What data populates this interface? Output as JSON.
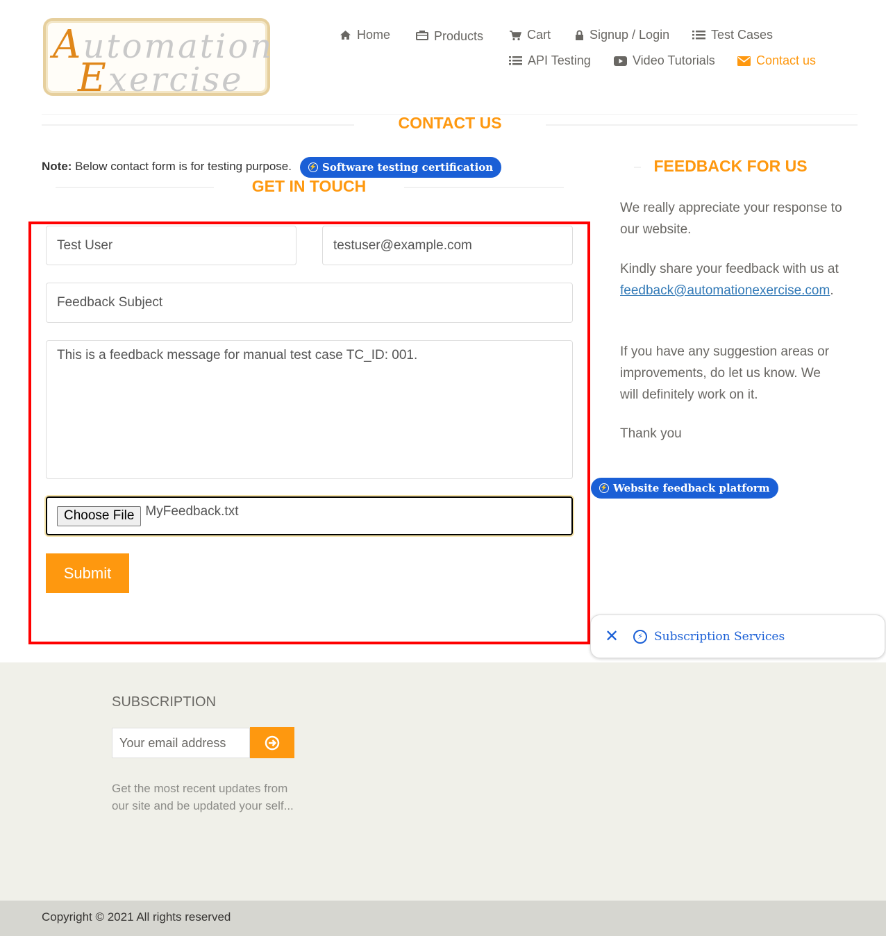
{
  "logo": {
    "line1_cap": "A",
    "line1": "utomation",
    "line2_cap": "E",
    "line2": "xercise"
  },
  "nav": {
    "home": "Home",
    "products": "Products",
    "cart": "Cart",
    "signup": "Signup / Login",
    "test_cases": "Test Cases",
    "api_testing": "API Testing",
    "video_tutorials": "Video Tutorials",
    "contact_us": "Contact us"
  },
  "contact": {
    "title": "CONTACT US",
    "note_bold": "Note:",
    "note_text": " Below contact form is for testing purpose.",
    "cert_pill": "Software testing certification",
    "get_in_touch": "GET IN TOUCH"
  },
  "form": {
    "name_value": "Test User",
    "email_value": "testuser@example.com",
    "subject_value": "Feedback Subject",
    "message_value": "This is a feedback message for manual test case TC_ID: 001.",
    "choose_file_label": "Choose File",
    "file_name": "MyFeedback.txt",
    "submit_label": "Submit"
  },
  "feedback": {
    "title": "FEEDBACK FOR US",
    "p1": "We really appreciate your response to our website.",
    "p2_prefix": "Kindly share your feedback with us at ",
    "email": "feedback@automationexercise.com",
    "p2_suffix": ".",
    "p3": "If you have any suggestion areas or improvements, do let us know. We will definitely work on it.",
    "p4": "Thank you",
    "platform_pill": "Website feedback platform"
  },
  "ad": {
    "label": "Subscription Services"
  },
  "footer": {
    "subscription_title": "SUBSCRIPTION",
    "email_placeholder": "Your email address",
    "description": "Get the most recent updates from our site and be updated your self...",
    "copyright": "Copyright © 2021 All rights reserved"
  },
  "colors": {
    "accent": "#fe980f",
    "highlight": "#ff0000",
    "pill": "#1a5fd6"
  }
}
